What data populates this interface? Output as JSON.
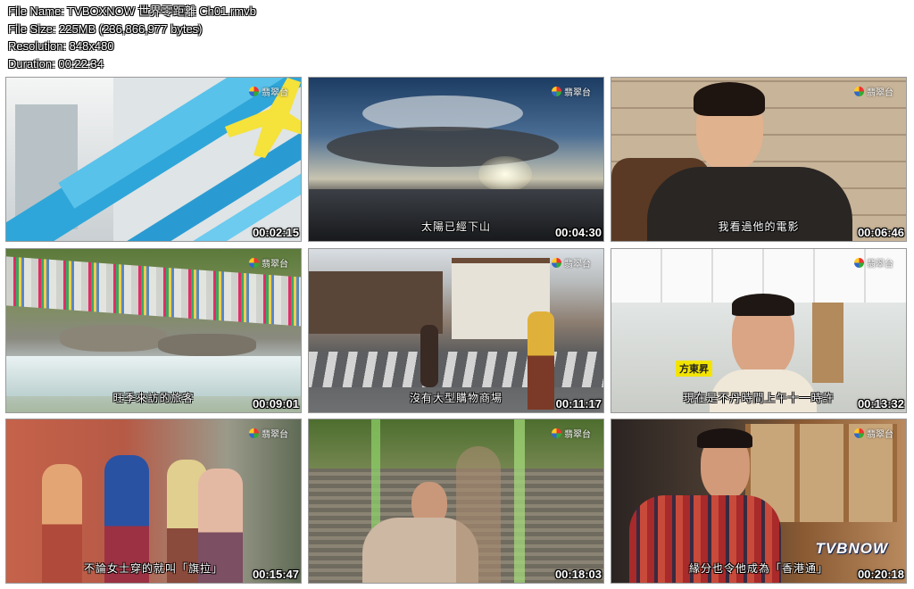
{
  "meta": {
    "file_name": "File Name: TVBOXNOW 世界零距離 Ch01.rmvb",
    "file_size": "File Size: 225MB (236,866,977 bytes)",
    "resolution": "Resolution: 848x480",
    "duration": "Duration: 00:22:34"
  },
  "channel_logo": "翡翠台",
  "thumbnails": [
    {
      "timestamp": "00:02:15",
      "subtitle": ""
    },
    {
      "timestamp": "00:04:30",
      "subtitle": "太陽已經下山"
    },
    {
      "timestamp": "00:06:46",
      "subtitle": "我看過他的電影"
    },
    {
      "timestamp": "00:09:01",
      "subtitle": "旺季來訪的旅客"
    },
    {
      "timestamp": "00:11:17",
      "subtitle": "沒有大型購物商場"
    },
    {
      "timestamp": "00:13:32",
      "subtitle": "現在是不丹時間上午十一時許",
      "name_tag": "方東昇"
    },
    {
      "timestamp": "00:15:47",
      "subtitle": "不論女士穿的就叫「旗拉」"
    },
    {
      "timestamp": "00:18:03",
      "subtitle": ""
    },
    {
      "timestamp": "00:20:18",
      "subtitle": "緣分也令他成為「香港通」",
      "watermark": "TVBNOW"
    }
  ]
}
